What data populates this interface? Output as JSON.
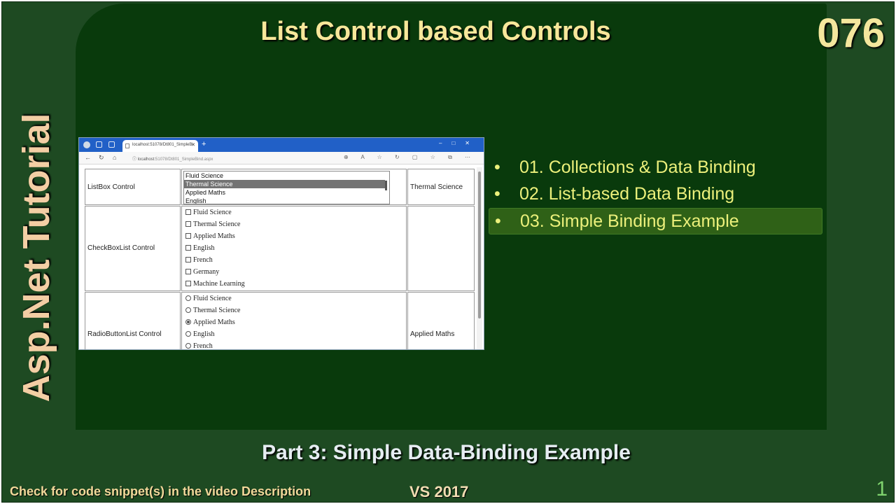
{
  "slide": {
    "title": "List Control based Controls",
    "episode": "076",
    "side_title": "Asp.Net Tutorial",
    "subtitle": "Part 3: Simple Data-Binding Example",
    "note": "Check for code snippet(s) in the video Description",
    "version": "VS 2017",
    "page_number": "1"
  },
  "bullets": [
    {
      "text": "01. Collections & Data Binding",
      "active": false
    },
    {
      "text": "02. List-based Data Binding",
      "active": false
    },
    {
      "text": "03. Simple Binding Example",
      "active": true
    }
  ],
  "browser": {
    "tab_title": "localhost:51078/Dt801_SimpleBi",
    "url_host": "localhost:",
    "url_rest": "51078/Dt801_SimpleBind.aspx",
    "listbox_row": {
      "label": "ListBox Control",
      "items": [
        "Fluid Science",
        "Thermal Science",
        "Applied Maths",
        "English"
      ],
      "selected_index": 1,
      "result": "Thermal Science"
    },
    "checkbox_row": {
      "label": "CheckBoxList Control",
      "items": [
        "Fluid Science",
        "Thermal Science",
        "Applied Maths",
        "English",
        "French",
        "Germany",
        "Machine Learning"
      ],
      "result": ""
    },
    "radio_row": {
      "label": "RadioButtonList Control",
      "items": [
        "Fluid Science",
        "Thermal Science",
        "Applied Maths",
        "English",
        "French"
      ],
      "selected_index": 2,
      "result": "Applied Maths"
    }
  },
  "colors": {
    "slide_bg": "#1e4a22",
    "panel_bg": "#093a0c",
    "title": "#f7e79a",
    "bullet_text": "#ecf07b",
    "active_bullet_bg": "#2f6117",
    "browser_chrome": "#2160c7"
  }
}
